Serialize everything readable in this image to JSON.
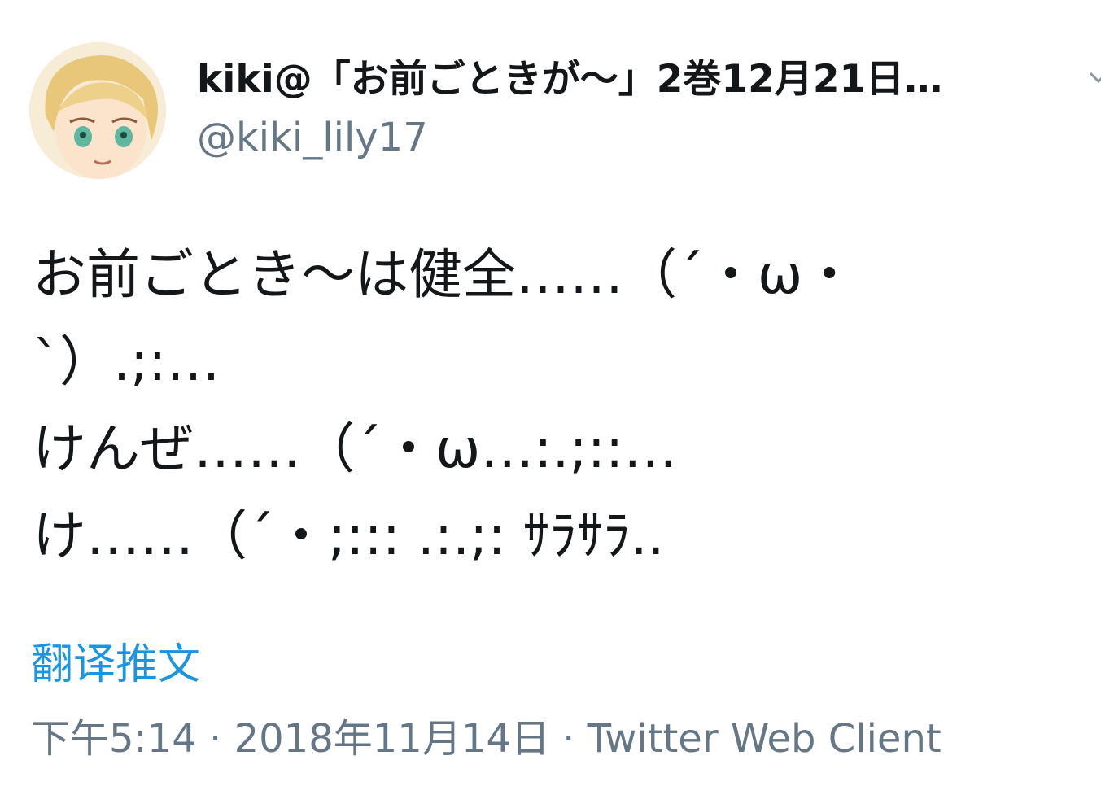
{
  "tweet": {
    "author": {
      "display_name": "kiki@「お前ごときが～」2巻12月21日…",
      "handle": "@kiki_lily17",
      "avatar_icon": "user-avatar"
    },
    "menu_icon": "chevron-down-icon",
    "text_lines": [
      "お前ごとき～は健全……（´・ω・",
      "`）.;:…",
      "けんぜ……（´・ω…:.;::…",
      "け……（´・;::: .:.;: ｻﾗｻﾗ.."
    ],
    "translate_label": "翻译推文",
    "meta": {
      "time": "下午5:14",
      "separator": " · ",
      "date": "2018年11月14日",
      "client": "Twitter Web Client"
    }
  },
  "colors": {
    "primary_text": "#14171a",
    "secondary_text": "#657786",
    "link": "#1b95e0",
    "background": "#ffffff"
  }
}
